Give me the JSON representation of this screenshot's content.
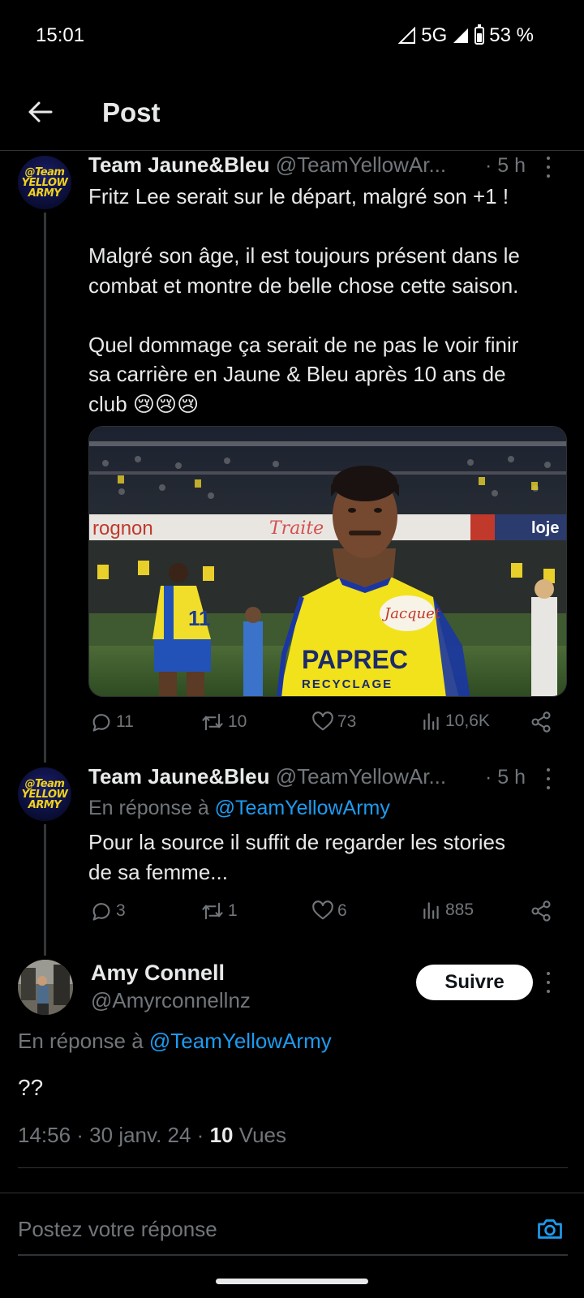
{
  "status_bar": {
    "time": "15:01",
    "network": "5G",
    "battery": "53 %"
  },
  "header": {
    "title": "Post"
  },
  "posts": [
    {
      "name": "Team Jaune&Bleu",
      "handle": "@TeamYellowAr...",
      "time": "· 5 h",
      "avatar_text": [
        "@Team",
        "YELLOW",
        "ARMY"
      ],
      "text_lines": [
        "Fritz Lee serait sur le départ, malgré son +1 !",
        "",
        "Malgré son âge, il est toujours présent dans le",
        "combat et montre de belle chose cette saison.",
        "",
        "Quel dommage ça serait de ne pas le voir finir",
        "sa carrière en Jaune & Bleu après 10 ans de",
        "club 😢😢😢"
      ],
      "image_banner": [
        "rognon",
        "Traite",
        "loje"
      ],
      "jersey_text": {
        "sponsor": "PAPREC",
        "sub": "RECYCLAGE",
        "badge": "Jacquet",
        "number": "11"
      },
      "stats": {
        "replies": "11",
        "reposts": "10",
        "likes": "73",
        "views": "10,6K"
      }
    },
    {
      "name": "Team Jaune&Bleu",
      "handle": "@TeamYellowAr...",
      "time": "· 5 h",
      "avatar_text": [
        "@Team",
        "YELLOW",
        "ARMY"
      ],
      "reply_prefix": "En réponse à",
      "reply_to": "@TeamYellowArmy",
      "text_lines": [
        "Pour la source il suffit de regarder les stories",
        "de sa femme..."
      ],
      "stats": {
        "replies": "3",
        "reposts": "1",
        "likes": "6",
        "views": "885"
      }
    }
  ],
  "main_post": {
    "name": "Amy Connell",
    "handle": "@Amyrconnellnz",
    "follow_label": "Suivre",
    "reply_prefix": "En réponse à",
    "reply_to": "@TeamYellowArmy",
    "text": "??",
    "date": "14:56 · 30 janv. 24 ·",
    "views_count": "10",
    "views_label": "Vues"
  },
  "composer": {
    "placeholder": "Postez votre réponse"
  },
  "colors": {
    "background": "#000000",
    "text": "#e7e9ea",
    "muted": "#71767b",
    "link": "#1d9bf0",
    "divider": "#2f3336"
  }
}
